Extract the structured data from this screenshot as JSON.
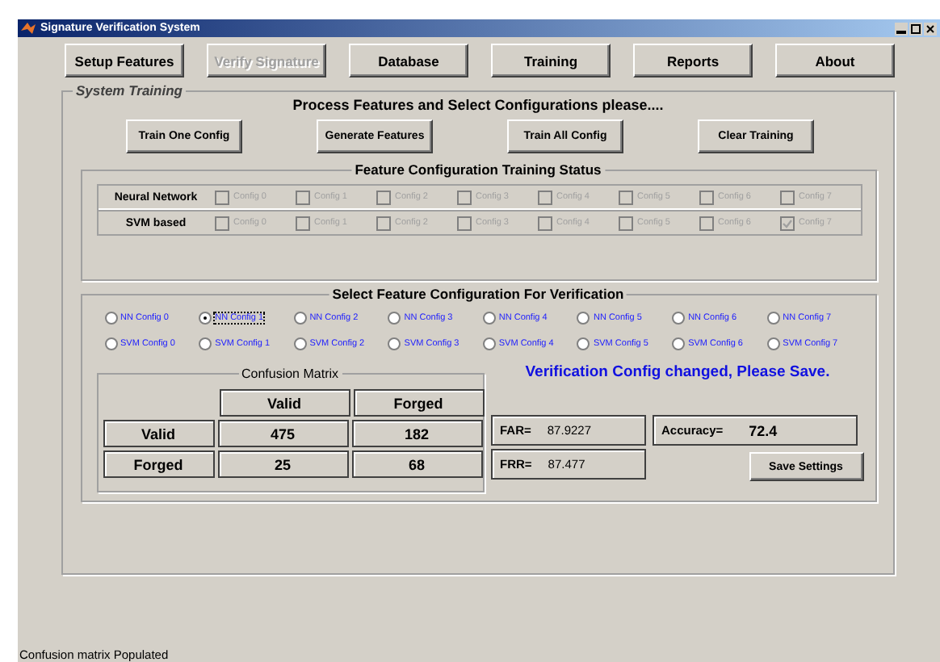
{
  "window": {
    "title": "Signature Verification System"
  },
  "menu": [
    {
      "label": "Setup Features",
      "disabled": false
    },
    {
      "label": "Verify Signature",
      "disabled": true
    },
    {
      "label": "Database",
      "disabled": false
    },
    {
      "label": "Training",
      "disabled": false
    },
    {
      "label": "Reports",
      "disabled": false
    },
    {
      "label": "About",
      "disabled": false
    }
  ],
  "panel": {
    "title": "System Training",
    "prompt": "Process  Features and Select Configurations please....",
    "actions": [
      "Train One Config",
      "Generate Features",
      "Train All Config",
      "Clear Training"
    ]
  },
  "training_status": {
    "title": "Feature Configuration Training Status",
    "rows": [
      {
        "label": "Neural Network",
        "configs": [
          {
            "label": "Config 0",
            "checked": false,
            "disabled": true
          },
          {
            "label": "Config 1",
            "checked": false,
            "disabled": true
          },
          {
            "label": "Config 2",
            "checked": false,
            "disabled": true
          },
          {
            "label": "Config 3",
            "checked": false,
            "disabled": true
          },
          {
            "label": "Config 4",
            "checked": false,
            "disabled": true
          },
          {
            "label": "Config 5",
            "checked": false,
            "disabled": true
          },
          {
            "label": "Config 6",
            "checked": false,
            "disabled": true
          },
          {
            "label": "Config 7",
            "checked": false,
            "disabled": true
          }
        ]
      },
      {
        "label": "SVM based",
        "configs": [
          {
            "label": "Config 0",
            "checked": false,
            "disabled": true
          },
          {
            "label": "Config 1",
            "checked": false,
            "disabled": true
          },
          {
            "label": "Config 2",
            "checked": false,
            "disabled": true
          },
          {
            "label": "Config 3",
            "checked": false,
            "disabled": true
          },
          {
            "label": "Config 4",
            "checked": false,
            "disabled": true
          },
          {
            "label": "Config 5",
            "checked": false,
            "disabled": true
          },
          {
            "label": "Config 6",
            "checked": false,
            "disabled": true
          },
          {
            "label": "Config 7",
            "checked": true,
            "disabled": true
          }
        ]
      }
    ]
  },
  "verification": {
    "title": "Select Feature Configuration For Verification",
    "options": [
      [
        {
          "label": "NN Config 0",
          "selected": false
        },
        {
          "label": "NN Config 1",
          "selected": true
        },
        {
          "label": "NN Config 2",
          "selected": false
        },
        {
          "label": "NN Config 3",
          "selected": false
        },
        {
          "label": "NN Config 4",
          "selected": false
        },
        {
          "label": "NN Config 5",
          "selected": false
        },
        {
          "label": "NN Config 6",
          "selected": false
        },
        {
          "label": "NN Config 7",
          "selected": false
        }
      ],
      [
        {
          "label": "SVM Config 0",
          "selected": false
        },
        {
          "label": "SVM Config 1",
          "selected": false
        },
        {
          "label": "SVM Config 2",
          "selected": false
        },
        {
          "label": "SVM Config 3",
          "selected": false
        },
        {
          "label": "SVM Config 4",
          "selected": false
        },
        {
          "label": "SVM Config 5",
          "selected": false
        },
        {
          "label": "SVM Config 6",
          "selected": false
        },
        {
          "label": "SVM Config 7",
          "selected": false
        }
      ]
    ],
    "confusion_matrix": {
      "title": "Confusion Matrix",
      "columns": [
        "Valid",
        "Forged"
      ],
      "rows": [
        {
          "label": "Valid",
          "cells": [
            "475",
            "182"
          ]
        },
        {
          "label": "Forged",
          "cells": [
            "25",
            "68"
          ]
        }
      ]
    },
    "message": "Verification Config changed, Please Save.",
    "error_rates": [
      {
        "label": "FAR=",
        "value": "87.9227"
      },
      {
        "label": "FRR=",
        "value": "87.477"
      }
    ],
    "accuracy": {
      "label": "Accuracy=",
      "value": "72.4"
    },
    "save_button": "Save Settings"
  },
  "status_bar": "Confusion matrix Populated"
}
